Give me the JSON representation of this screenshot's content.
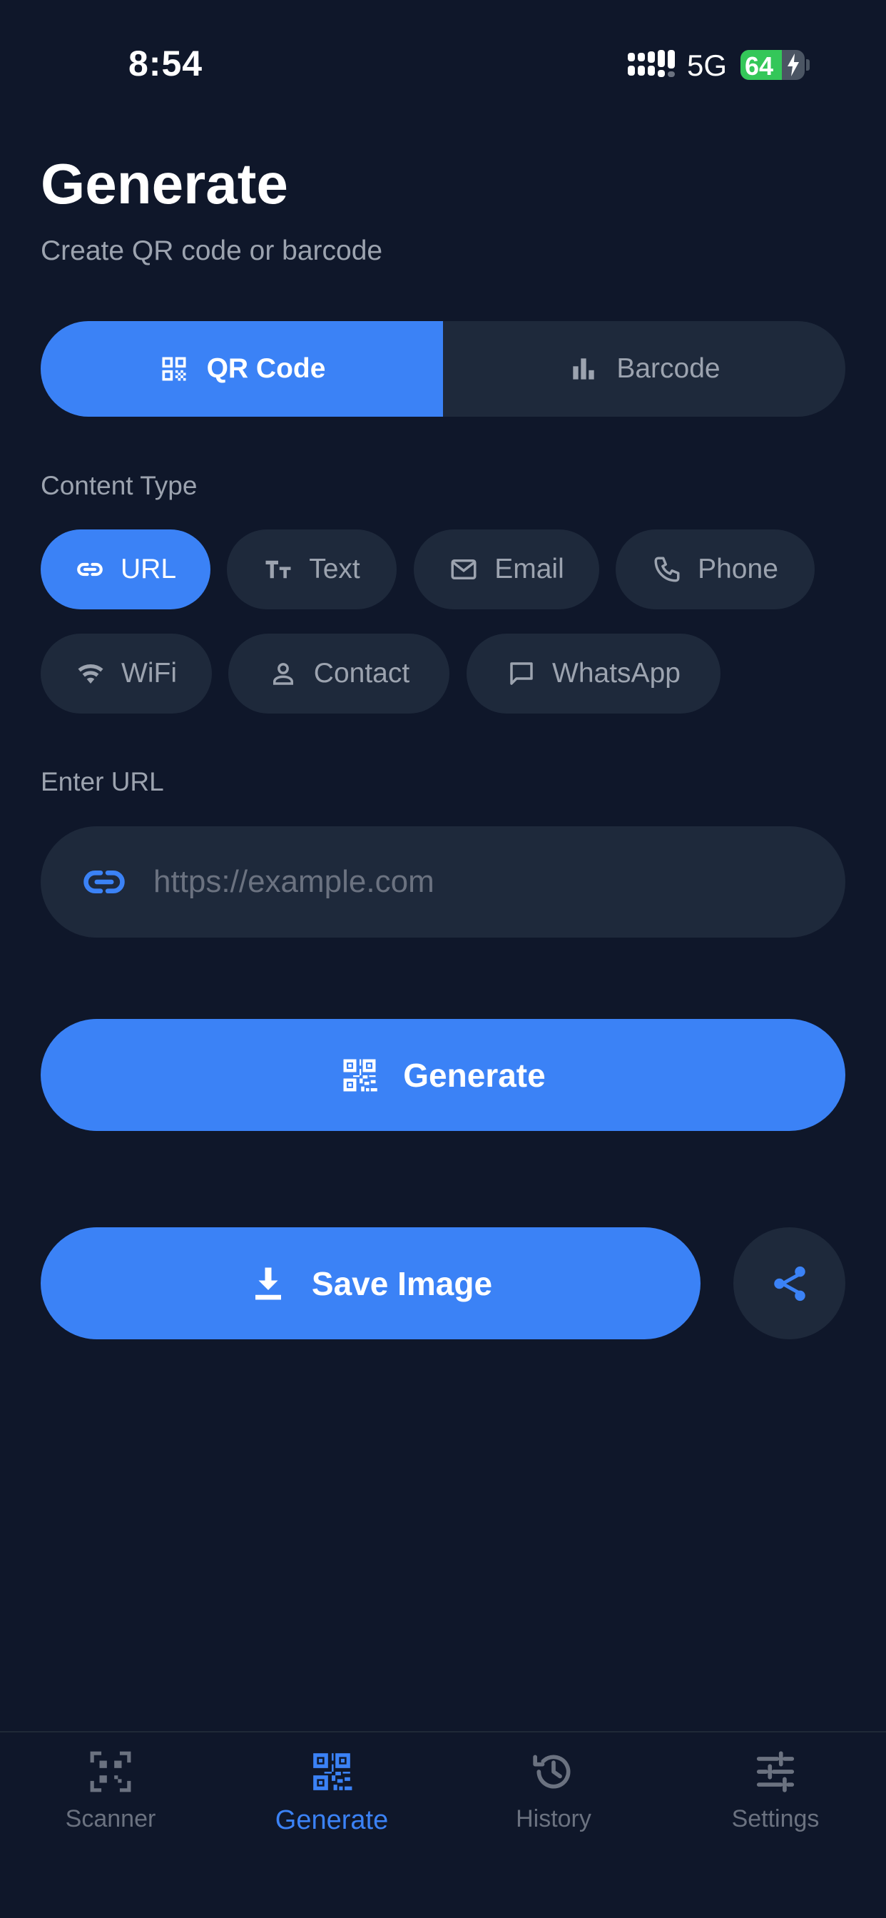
{
  "status_bar": {
    "time": "8:54",
    "network": "5G",
    "battery": "64",
    "battery_level": 0.64
  },
  "header": {
    "title": "Generate",
    "subtitle": "Create QR code or barcode"
  },
  "segmented": {
    "qr_label": "QR Code",
    "barcode_label": "Barcode",
    "selected": "QR Code"
  },
  "content_type": {
    "label": "Content Type",
    "chips": [
      {
        "label": "URL",
        "icon": "link-icon",
        "active": true
      },
      {
        "label": "Text",
        "icon": "text-icon",
        "active": false
      },
      {
        "label": "Email",
        "icon": "mail-icon",
        "active": false
      },
      {
        "label": "Phone",
        "icon": "phone-icon",
        "active": false
      },
      {
        "label": "WiFi",
        "icon": "wifi-icon",
        "active": false
      },
      {
        "label": "Contact",
        "icon": "person-icon",
        "active": false
      },
      {
        "label": "WhatsApp",
        "icon": "chat-icon",
        "active": false
      }
    ]
  },
  "input": {
    "label": "Enter URL",
    "placeholder": "https://example.com",
    "value": ""
  },
  "actions": {
    "generate_label": "Generate",
    "save_label": "Save Image"
  },
  "tabs": [
    {
      "label": "Scanner",
      "icon": "qr-scan-icon",
      "active": false
    },
    {
      "label": "Generate",
      "icon": "qr-code-icon",
      "active": true
    },
    {
      "label": "History",
      "icon": "history-icon",
      "active": false
    },
    {
      "label": "Settings",
      "icon": "sliders-icon",
      "active": false
    }
  ],
  "colors": {
    "background": "#0f172a",
    "surface": "#1e293b",
    "accent": "#3b82f6",
    "muted": "#9ca3af",
    "battery": "#34c759"
  }
}
